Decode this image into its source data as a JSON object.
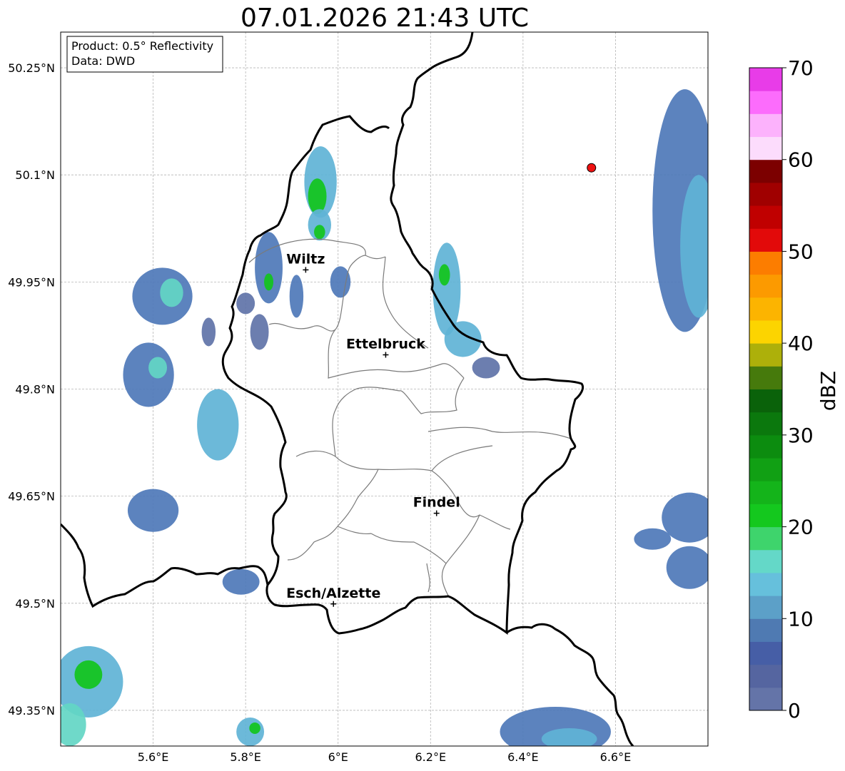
{
  "title": "07.01.2026 21:43 UTC",
  "info_box": {
    "product": "Product: 0.5° Reflectivity",
    "source": "Data: DWD"
  },
  "extent": {
    "lon": [
      5.4,
      6.8
    ],
    "lat": [
      49.3,
      50.3
    ]
  },
  "lon_ticks": [
    {
      "value": 5.6,
      "label": "5.6°E"
    },
    {
      "value": 5.8,
      "label": "5.8°E"
    },
    {
      "value": 6.0,
      "label": "6°E"
    },
    {
      "value": 6.2,
      "label": "6.2°E"
    },
    {
      "value": 6.4,
      "label": "6.4°E"
    },
    {
      "value": 6.6,
      "label": "6.6°E"
    }
  ],
  "lat_ticks": [
    {
      "value": 50.25,
      "label": "50.25°N"
    },
    {
      "value": 50.1,
      "label": "50.1°N"
    },
    {
      "value": 49.95,
      "label": "49.95°N"
    },
    {
      "value": 49.8,
      "label": "49.8°N"
    },
    {
      "value": 49.65,
      "label": "49.65°N"
    },
    {
      "value": 49.5,
      "label": "49.5°N"
    },
    {
      "value": 49.35,
      "label": "49.35°N"
    }
  ],
  "cities": [
    {
      "name": "Wiltz",
      "lon": 5.93,
      "lat": 49.967
    },
    {
      "name": "Ettelbruck",
      "lon": 6.103,
      "lat": 49.848
    },
    {
      "name": "Findel",
      "lon": 6.213,
      "lat": 49.626
    },
    {
      "name": "Esch/Alzette",
      "lon": 5.99,
      "lat": 49.499
    }
  ],
  "radar_site": {
    "lon": 6.548,
    "lat": 50.11,
    "color": "#ee1111"
  },
  "colorbar": {
    "label": "dBZ",
    "min": 0,
    "max": 70,
    "tick_labels": [
      "0",
      "10",
      "20",
      "30",
      "40",
      "50",
      "60",
      "70"
    ],
    "tick_values": [
      0,
      10,
      20,
      30,
      40,
      50,
      60,
      70
    ],
    "colors": [
      "#6474a8",
      "#5565a0",
      "#465ea6",
      "#4f7ab2",
      "#5ca0c8",
      "#66c0dc",
      "#64d8c8",
      "#3ed46c",
      "#14c81e",
      "#14b41a",
      "#11a014",
      "#0c8c0f",
      "#0b780d",
      "#0a620a",
      "#467a0c",
      "#adb00a",
      "#fcd400",
      "#fcb400",
      "#fc9a00",
      "#fc7d00",
      "#e20a0a",
      "#c00000",
      "#a00000",
      "#7c0000",
      "#fcdcfc",
      "#fcb2fc",
      "#fc6cfc",
      "#e83ce8"
    ]
  },
  "echo_colors": {
    "weak": "#5f73a8",
    "light": "#4e78b8",
    "mid": "#5fb3d6",
    "cyan": "#63d6c4",
    "green": "#12c41c"
  },
  "echoes": [
    {
      "lon": 5.962,
      "lat": 50.09,
      "rlon": 0.035,
      "rlat": 0.05,
      "level": "mid"
    },
    {
      "lon": 5.955,
      "lat": 50.07,
      "rlon": 0.02,
      "rlat": 0.025,
      "level": "green"
    },
    {
      "lon": 5.96,
      "lat": 50.03,
      "rlon": 0.025,
      "rlat": 0.022,
      "level": "mid"
    },
    {
      "lon": 5.96,
      "lat": 50.02,
      "rlon": 0.012,
      "rlat": 0.01,
      "level": "green"
    },
    {
      "lon": 5.85,
      "lat": 49.97,
      "rlon": 0.03,
      "rlat": 0.05,
      "level": "light"
    },
    {
      "lon": 5.85,
      "lat": 49.95,
      "rlon": 0.01,
      "rlat": 0.012,
      "level": "green"
    },
    {
      "lon": 5.91,
      "lat": 49.93,
      "rlon": 0.015,
      "rlat": 0.03,
      "level": "light"
    },
    {
      "lon": 6.005,
      "lat": 49.95,
      "rlon": 0.022,
      "rlat": 0.022,
      "level": "light"
    },
    {
      "lon": 5.83,
      "lat": 49.88,
      "rlon": 0.02,
      "rlat": 0.025,
      "level": "weak"
    },
    {
      "lon": 5.72,
      "lat": 49.88,
      "rlon": 0.015,
      "rlat": 0.02,
      "level": "weak"
    },
    {
      "lon": 5.8,
      "lat": 49.92,
      "rlon": 0.02,
      "rlat": 0.015,
      "level": "weak"
    },
    {
      "lon": 5.62,
      "lat": 49.93,
      "rlon": 0.065,
      "rlat": 0.04,
      "level": "light"
    },
    {
      "lon": 5.64,
      "lat": 49.935,
      "rlon": 0.025,
      "rlat": 0.02,
      "level": "cyan"
    },
    {
      "lon": 5.59,
      "lat": 49.82,
      "rlon": 0.055,
      "rlat": 0.045,
      "level": "light"
    },
    {
      "lon": 5.61,
      "lat": 49.83,
      "rlon": 0.02,
      "rlat": 0.015,
      "level": "cyan"
    },
    {
      "lon": 5.74,
      "lat": 49.75,
      "rlon": 0.045,
      "rlat": 0.05,
      "level": "mid"
    },
    {
      "lon": 5.6,
      "lat": 49.63,
      "rlon": 0.055,
      "rlat": 0.03,
      "level": "light"
    },
    {
      "lon": 5.79,
      "lat": 49.53,
      "rlon": 0.04,
      "rlat": 0.018,
      "level": "light"
    },
    {
      "lon": 5.46,
      "lat": 49.39,
      "rlon": 0.075,
      "rlat": 0.05,
      "level": "mid"
    },
    {
      "lon": 5.46,
      "lat": 49.4,
      "rlon": 0.03,
      "rlat": 0.02,
      "level": "green"
    },
    {
      "lon": 5.42,
      "lat": 49.33,
      "rlon": 0.035,
      "rlat": 0.03,
      "level": "cyan"
    },
    {
      "lon": 5.81,
      "lat": 49.32,
      "rlon": 0.03,
      "rlat": 0.02,
      "level": "mid"
    },
    {
      "lon": 5.82,
      "lat": 49.325,
      "rlon": 0.012,
      "rlat": 0.008,
      "level": "green"
    },
    {
      "lon": 6.235,
      "lat": 49.94,
      "rlon": 0.03,
      "rlat": 0.065,
      "level": "mid"
    },
    {
      "lon": 6.23,
      "lat": 49.96,
      "rlon": 0.012,
      "rlat": 0.015,
      "level": "green"
    },
    {
      "lon": 6.27,
      "lat": 49.87,
      "rlon": 0.04,
      "rlat": 0.025,
      "level": "mid"
    },
    {
      "lon": 6.32,
      "lat": 49.83,
      "rlon": 0.03,
      "rlat": 0.015,
      "level": "weak"
    },
    {
      "lon": 6.75,
      "lat": 50.05,
      "rlon": 0.07,
      "rlat": 0.17,
      "level": "light"
    },
    {
      "lon": 6.78,
      "lat": 50.0,
      "rlon": 0.04,
      "rlat": 0.1,
      "level": "mid"
    },
    {
      "lon": 6.76,
      "lat": 49.62,
      "rlon": 0.06,
      "rlat": 0.035,
      "level": "light"
    },
    {
      "lon": 6.68,
      "lat": 49.59,
      "rlon": 0.04,
      "rlat": 0.015,
      "level": "light"
    },
    {
      "lon": 6.76,
      "lat": 49.55,
      "rlon": 0.05,
      "rlat": 0.03,
      "level": "light"
    },
    {
      "lon": 6.47,
      "lat": 49.32,
      "rlon": 0.12,
      "rlat": 0.035,
      "level": "light"
    },
    {
      "lon": 6.5,
      "lat": 49.31,
      "rlon": 0.06,
      "rlat": 0.015,
      "level": "mid"
    }
  ]
}
